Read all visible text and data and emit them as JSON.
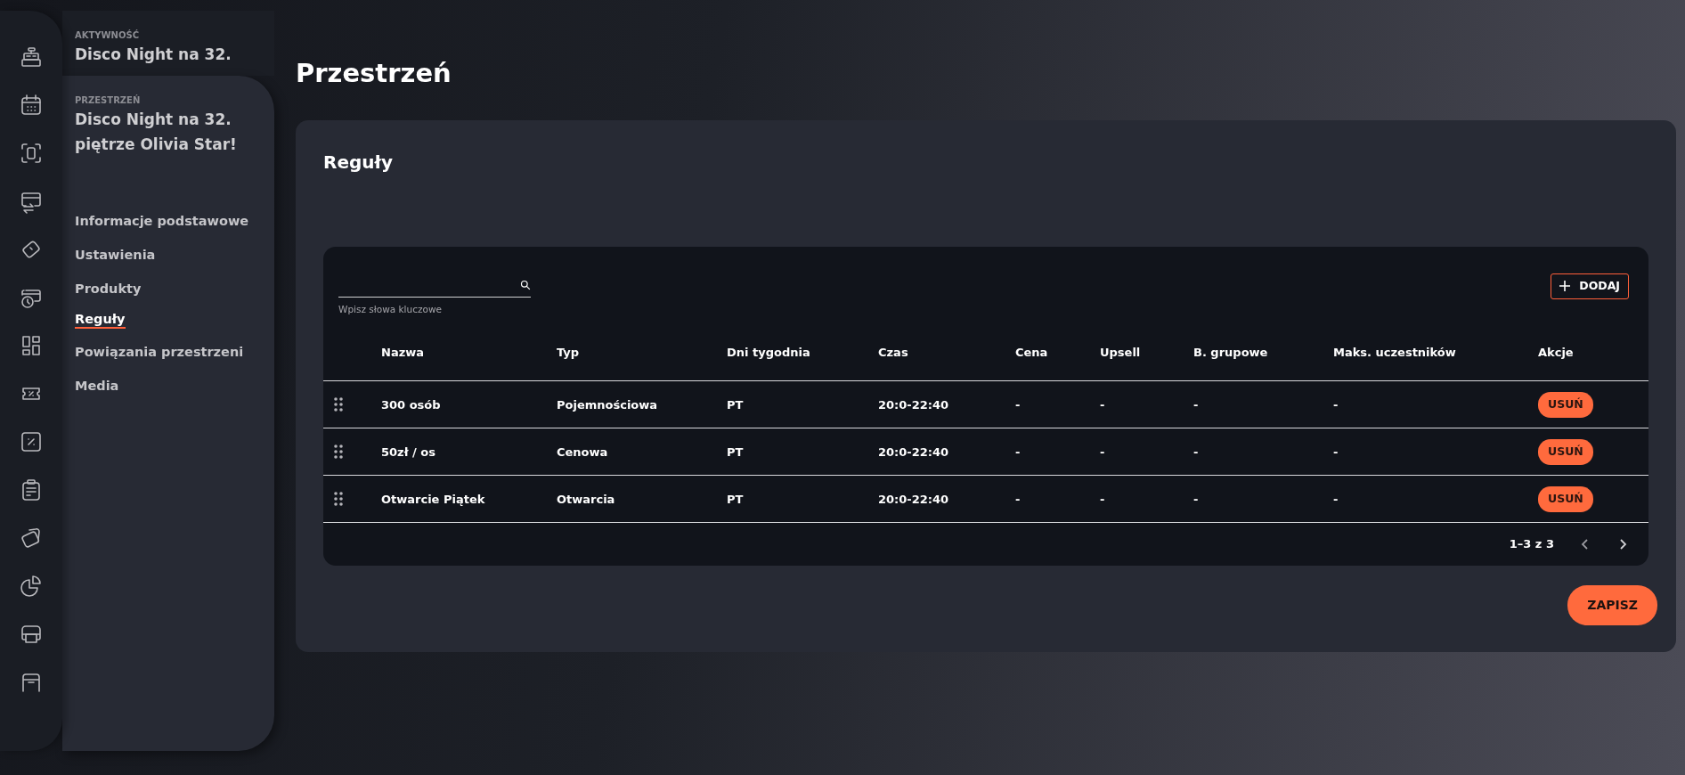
{
  "sidebar": {
    "activity": {
      "label": "AKTYWNOŚĆ",
      "name": "Disco Night na 32."
    },
    "space": {
      "label": "PRZESTRZEŃ",
      "name": "Disco Night na 32. piętrze Olivia Star!"
    },
    "items": [
      {
        "label": "Informacje podstawowe",
        "selected": false
      },
      {
        "label": "Ustawienia",
        "selected": false
      },
      {
        "label": "Produkty",
        "selected": false
      },
      {
        "label": "Reguły",
        "selected": true
      },
      {
        "label": "Powiązania przestrzeni",
        "selected": false
      },
      {
        "label": "Media",
        "selected": false
      }
    ]
  },
  "page_title": "Przestrzeń",
  "section": {
    "title": "Reguły",
    "search": {
      "helper_text": "Wpisz słowa kluczowe"
    },
    "add_button": "DODAJ",
    "table": {
      "columns": [
        "Nazwa",
        "Typ",
        "Dni tygodnia",
        "Czas",
        "Cena",
        "Upsell",
        "B. grupowe",
        "Maks. uczestników",
        "Akcje"
      ],
      "rows": [
        {
          "cells": [
            "300 osób",
            "Pojemnościowa",
            "PT",
            "20:0-22:40",
            "-",
            "-",
            "-",
            "-"
          ],
          "action": "USUŃ"
        },
        {
          "cells": [
            "50zł / os",
            "Cenowa",
            "PT",
            "20:0-22:40",
            "-",
            "-",
            "-",
            "-"
          ],
          "action": "USUŃ"
        },
        {
          "cells": [
            "Otwarcie Piątek",
            "Otwarcia",
            "PT",
            "20:0-22:40",
            "-",
            "-",
            "-",
            "-"
          ],
          "action": "USUŃ"
        }
      ]
    },
    "pagination": {
      "range": "1–3 z 3"
    },
    "save_button": "ZAPISZ"
  }
}
